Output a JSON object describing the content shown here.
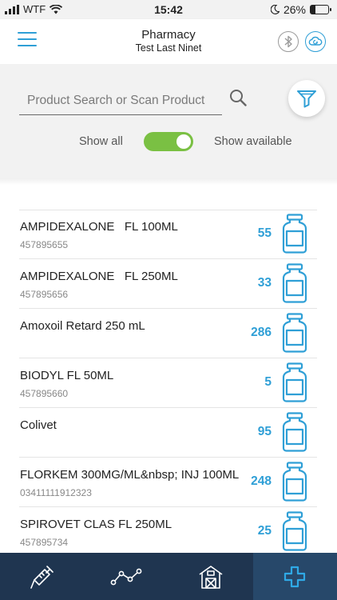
{
  "status_bar": {
    "carrier": "WTF",
    "time": "15:42",
    "battery_percent": "26%",
    "battery_level": 0.26
  },
  "header": {
    "title": "Pharmacy",
    "subtitle": "Test Last Ninet",
    "menu_icon": "hamburger-menu-icon",
    "bluetooth_icon": "bluetooth-icon",
    "cloud_icon": "cloud-sync-icon"
  },
  "search": {
    "placeholder": "Product Search or Scan Product",
    "value": ""
  },
  "filter": {
    "show_all_label": "Show all",
    "show_available_label": "Show available",
    "toggle_on": true
  },
  "colors": {
    "accent": "#2f9fd6",
    "toggle_green": "#7ac043",
    "nav_bg": "#1f3550",
    "nav_active_bg": "#27486a"
  },
  "products": [
    {
      "name": "AMPIDEXALONE   FL 100ML",
      "code": "457895655",
      "quantity": "55"
    },
    {
      "name": "AMPIDEXALONE   FL 250ML",
      "code": "457895656",
      "quantity": "33"
    },
    {
      "name": "Amoxoil Retard 250 mL",
      "code": "",
      "quantity": "286"
    },
    {
      "name": "BIODYL FL 50ML",
      "code": "457895660",
      "quantity": "5"
    },
    {
      "name": "Colivet",
      "code": "",
      "quantity": "95"
    },
    {
      "name": "FLORKEM 300MG/ML&nbsp; INJ 100ML",
      "code": "03411111912323",
      "quantity": "248"
    },
    {
      "name": "SPIROVET CLAS FL 250ML",
      "code": "457895734",
      "quantity": "25"
    }
  ],
  "bottom_nav": [
    {
      "icon": "syringe-icon",
      "active": false
    },
    {
      "icon": "line-graph-icon",
      "active": false
    },
    {
      "icon": "farm-barn-icon",
      "active": false
    },
    {
      "icon": "medical-cross-icon",
      "active": true
    }
  ]
}
